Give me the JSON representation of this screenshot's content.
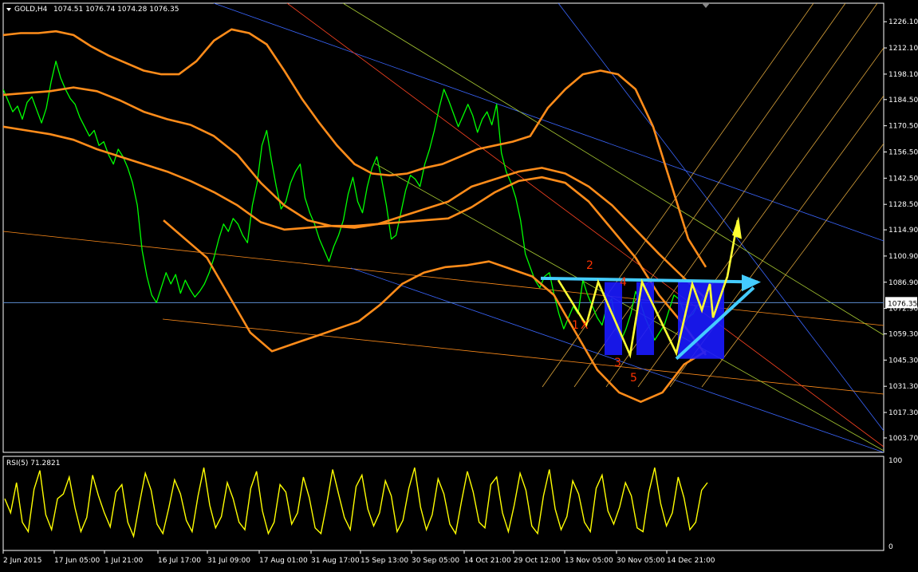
{
  "header": {
    "symbol_label": "GOLD,H4",
    "ohlc_text": "1074.51 1076.74 1074.28 1076.35"
  },
  "current_price_label": "1076.35",
  "rsi_label": "RSI(5) 71.2821",
  "colors": {
    "background": "#000000",
    "candles": "#00ff00",
    "bands": "#ff8c1a",
    "rsi": "#ffff00",
    "neckline": "#44ccff",
    "rectangle": "#1a1aff",
    "arrow": "#ffff33",
    "wave_labels": "#ff3300",
    "axis_text": "#ffffff",
    "price_line": "#5b8ccf"
  },
  "chart_data": [
    {
      "type": "line",
      "title": "GOLD,H4",
      "ylim": [
        996.0,
        1236.0
      ],
      "y_ticks": [
        "1226.10",
        "1212.10",
        "1198.10",
        "1184.50",
        "1170.50",
        "1156.50",
        "1142.50",
        "1128.50",
        "1114.90",
        "1100.90",
        "1086.90",
        "1072.90",
        "1059.30",
        "1045.30",
        "1031.30",
        "1017.30",
        "1003.70"
      ],
      "x_ticks": [
        "2 Jun 2015",
        "17 Jun 05:00",
        "1 Jul 21:00",
        "16 Jul 17:00",
        "31 Jul 09:00",
        "17 Aug 01:00",
        "31 Aug 17:00",
        "15 Sep 13:00",
        "30 Sep 05:00",
        "14 Oct 21:00",
        "29 Oct 12:00",
        "13 Nov 05:00",
        "30 Nov 05:00",
        "14 Dec 21:00"
      ],
      "series": [
        {
          "role": "price",
          "values": [
            1190,
            1184,
            1178,
            1181,
            1174,
            1183,
            1186,
            1179,
            1172,
            1180,
            1194,
            1205,
            1196,
            1190,
            1185,
            1182,
            1175,
            1170,
            1165,
            1168,
            1160,
            1162,
            1155,
            1150,
            1158,
            1154,
            1148,
            1140,
            1128,
            1104,
            1090,
            1080,
            1076,
            1084,
            1092,
            1086,
            1091,
            1081,
            1088,
            1083,
            1079,
            1082,
            1086,
            1092,
            1100,
            1110,
            1118,
            1114,
            1121,
            1118,
            1112,
            1108,
            1128,
            1140,
            1160,
            1168,
            1152,
            1138,
            1126,
            1130,
            1140,
            1146,
            1150,
            1132,
            1124,
            1118,
            1110,
            1104,
            1098,
            1106,
            1112,
            1120,
            1134,
            1143,
            1130,
            1124,
            1138,
            1148,
            1154,
            1142,
            1128,
            1110,
            1112,
            1124,
            1136,
            1144,
            1142,
            1138,
            1150,
            1158,
            1168,
            1180,
            1190,
            1184,
            1177,
            1170,
            1176,
            1182,
            1176,
            1167,
            1174,
            1178,
            1171,
            1182,
            1156,
            1146,
            1140,
            1132,
            1120,
            1102,
            1095,
            1088,
            1084,
            1090,
            1092,
            1080,
            1070,
            1062,
            1068,
            1074,
            1070,
            1088,
            1080,
            1074,
            1068,
            1064,
            1074,
            1078,
            1062,
            1056,
            1062,
            1070,
            1082,
            1076,
            1068,
            1062,
            1056,
            1060,
            1064,
            1072,
            1080,
            1078,
            1072,
            1068,
            1070,
            1075,
            1078,
            1076
          ]
        },
        {
          "role": "band-upper-outer",
          "values": [
            1219,
            1220,
            1220,
            1221,
            1219,
            1213,
            1208,
            1204,
            1200,
            1198,
            1198,
            1205,
            1216,
            1222,
            1220,
            1214,
            1200,
            1185,
            1172,
            1160,
            1150,
            1145,
            1144,
            1145,
            1148,
            1150,
            1154,
            1158,
            1160,
            1162,
            1165,
            1180,
            1190,
            1198,
            1200,
            1198,
            1190,
            1170,
            1140,
            1110,
            1095
          ]
        },
        {
          "role": "band-upper-inner",
          "values": [
            1170,
            1168,
            1166,
            1163,
            1158,
            1154,
            1150,
            1146,
            1141,
            1135,
            1128,
            1119,
            1115,
            1116,
            1117,
            1117,
            1118,
            1119,
            1120,
            1121,
            1127,
            1135,
            1141,
            1143,
            1140,
            1130,
            1115,
            1100,
            1080,
            1065,
            1048
          ]
        },
        {
          "role": "band-middle",
          "values": [
            1187,
            1188,
            1189,
            1191,
            1189,
            1184,
            1178,
            1174,
            1171,
            1165,
            1155,
            1140,
            1128,
            1120,
            1117,
            1116,
            1118,
            1122,
            1126,
            1130,
            1138,
            1142,
            1146,
            1148,
            1145,
            1138,
            1128,
            1115,
            1102,
            1090,
            1078
          ]
        },
        {
          "role": "band-lower",
          "values": [
            1120,
            1110,
            1100,
            1080,
            1060,
            1050,
            1054,
            1058,
            1062,
            1066,
            1075,
            1086,
            1092,
            1095,
            1096,
            1098,
            1094,
            1090,
            1080,
            1060,
            1040,
            1028,
            1023,
            1028,
            1043,
            1050
          ]
        }
      ],
      "annotations": [
        {
          "text": "1",
          "price": 1062
        },
        {
          "text": "2",
          "price": 1094
        },
        {
          "text": "3",
          "price": 1042
        },
        {
          "text": "4",
          "price": 1085
        },
        {
          "text": "5",
          "price": 1034
        },
        {
          "text": "X",
          "price": 1062
        }
      ]
    },
    {
      "type": "line",
      "title": "RSI(5) 71.2821",
      "ylim": [
        0,
        100
      ],
      "y_ticks": [
        "100",
        "0"
      ],
      "values": [
        55,
        40,
        72,
        30,
        20,
        65,
        85,
        38,
        22,
        55,
        60,
        78,
        45,
        20,
        35,
        80,
        58,
        40,
        25,
        62,
        70,
        30,
        15,
        50,
        82,
        64,
        28,
        18,
        45,
        75,
        60,
        32,
        20,
        58,
        88,
        48,
        24,
        36,
        72,
        55,
        30,
        22,
        66,
        84,
        42,
        18,
        30,
        70,
        62,
        28,
        40,
        78,
        56,
        24,
        18,
        50,
        86,
        60,
        35,
        22,
        68,
        80,
        44,
        26,
        40,
        74,
        58,
        20,
        32,
        66,
        88,
        46,
        22,
        38,
        76,
        60,
        28,
        18,
        52,
        84,
        62,
        30,
        24,
        70,
        78,
        40,
        20,
        48,
        82,
        64,
        26,
        18,
        58,
        86,
        44,
        22,
        36,
        74,
        60,
        30,
        20,
        66,
        80,
        42,
        28,
        46,
        72,
        58,
        24,
        20,
        62,
        88,
        50,
        26,
        40,
        78,
        56,
        22,
        30,
        64,
        72
      ]
    }
  ]
}
